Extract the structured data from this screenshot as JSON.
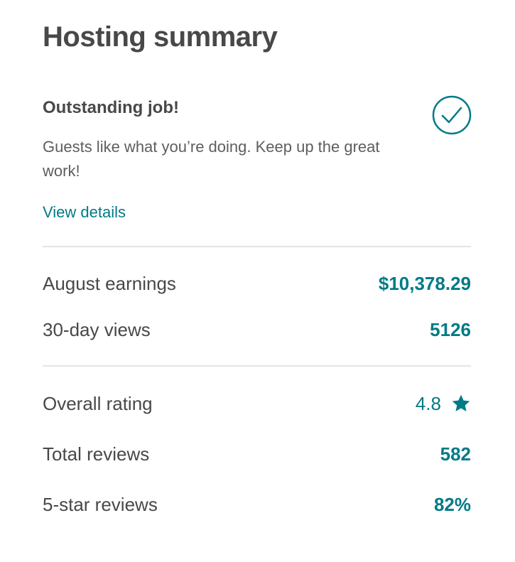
{
  "summary": {
    "title": "Hosting summary",
    "badge": {
      "heading": "Outstanding job!",
      "text": "Guests like what you’re doing. Keep up the great work!",
      "icon": "check-circle-icon",
      "link": "View details"
    },
    "earnings": {
      "label": "August earnings",
      "value": "$10,378.29"
    },
    "views": {
      "label": "30-day views",
      "value": "5126"
    },
    "rating": {
      "label": "Overall rating",
      "value": "4.8",
      "icon": "star-icon"
    },
    "total_reviews": {
      "label": "Total reviews",
      "value": "582"
    },
    "five_star": {
      "label": "5-star reviews",
      "value": "82%"
    }
  },
  "colors": {
    "accent": "#007a87",
    "text": "#484848",
    "divider": "#e4e4e4"
  }
}
